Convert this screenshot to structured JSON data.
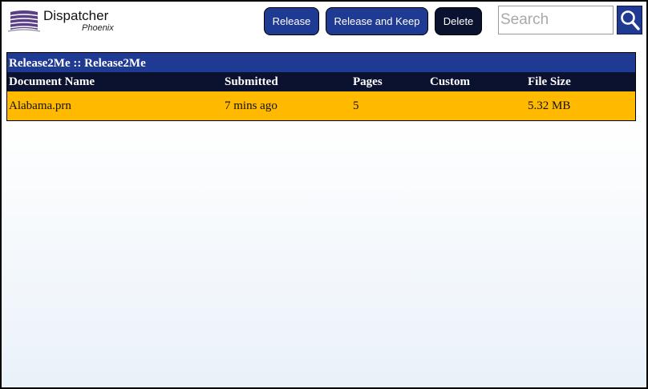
{
  "app": {
    "logo_title": "Dispatcher",
    "logo_subtitle": "Phoenix"
  },
  "toolbar": {
    "release_label": "Release",
    "release_keep_label": "Release and Keep",
    "delete_label": "Delete"
  },
  "search": {
    "placeholder": "Search",
    "value": "",
    "icon": "search-icon"
  },
  "queue": {
    "title": "Release2Me :: Release2Me",
    "columns": [
      "Document Name",
      "Submitted",
      "Pages",
      "Custom",
      "File Size"
    ],
    "rows": [
      {
        "document_name": "Alabama.prn",
        "submitted": "7 mins ago",
        "pages": "5",
        "custom": "",
        "file_size": "5.32 MB"
      }
    ]
  },
  "colors": {
    "accent_blue": "#1f3a93",
    "header_dark": "#0a1230",
    "row_highlight": "#ffba00"
  }
}
